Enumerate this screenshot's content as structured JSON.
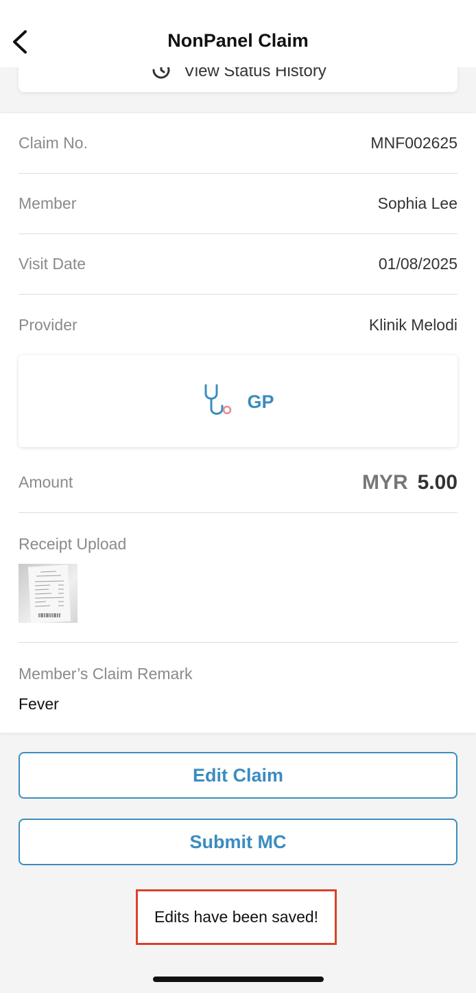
{
  "header": {
    "title": "NonPanel Claim"
  },
  "status_history": {
    "label": "View Status History"
  },
  "claim": {
    "rows": [
      {
        "label": "Claim No.",
        "value": "MNF002625"
      },
      {
        "label": "Member",
        "value": "Sophia Lee"
      },
      {
        "label": "Visit Date",
        "value": "01/08/2025"
      },
      {
        "label": "Provider",
        "value": "Klinik Melodi"
      }
    ],
    "provider_type": "GP",
    "amount": {
      "label": "Amount",
      "currency": "MYR",
      "value": "5.00"
    },
    "receipt": {
      "label": "Receipt Upload"
    },
    "remark": {
      "label": "Member’s Claim Remark",
      "value": "Fever"
    }
  },
  "actions": {
    "edit_label": "Edit Claim",
    "submit_label": "Submit MC"
  },
  "toast": {
    "message": "Edits have been saved!"
  },
  "colors": {
    "accent": "#3a8cc0",
    "toast_border": "#d8432b"
  },
  "icons": [
    "back-arrow-icon",
    "history-icon",
    "stethoscope-icon"
  ]
}
